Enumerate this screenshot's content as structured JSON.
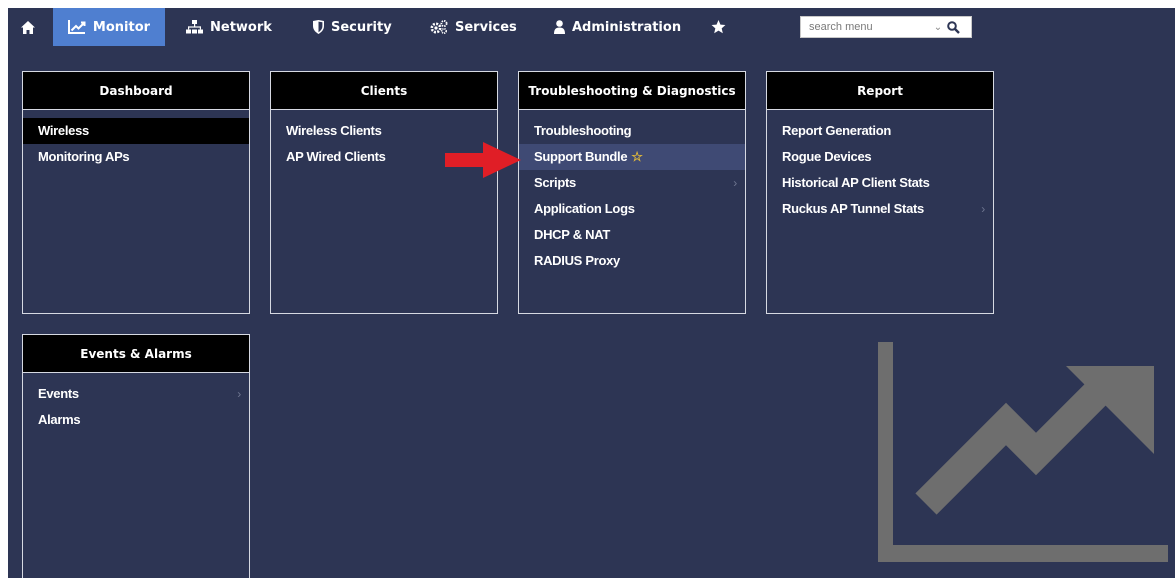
{
  "topnav": {
    "monitor": "Monitor",
    "network": "Network",
    "security": "Security",
    "services": "Services",
    "administration": "Administration",
    "search_placeholder": "search menu"
  },
  "icons": {
    "home": "home-icon",
    "monitor": "line-chart-icon",
    "network": "sitemap-icon",
    "security": "shield-icon",
    "services": "gears-icon",
    "administration": "user-icon",
    "favorites": "star-icon",
    "search": "search-icon",
    "pointer": "red-arrow-icon",
    "background": "trending-chart-icon"
  },
  "colors": {
    "background": "#2d3554",
    "active_tab": "#4f7fd0",
    "card_header": "#000000",
    "highlight_row": "#3f4a74",
    "arrow": "#e01e26",
    "favorite_star": "#e0b83a"
  },
  "cards": {
    "dashboard": {
      "title": "Dashboard",
      "items": [
        "Wireless",
        "Monitoring APs"
      ],
      "selected": "Wireless"
    },
    "clients": {
      "title": "Clients",
      "items": [
        "Wireless Clients",
        "AP Wired Clients"
      ]
    },
    "troubleshooting": {
      "title": "Troubleshooting & Diagnostics",
      "items": [
        "Troubleshooting",
        "Support Bundle",
        "Scripts",
        "Application Logs",
        "DHCP & NAT",
        "RADIUS Proxy"
      ],
      "highlighted": "Support Bundle"
    },
    "report": {
      "title": "Report",
      "items": [
        "Report Generation",
        "Rogue Devices",
        "Historical AP Client Stats",
        "Ruckus AP Tunnel Stats"
      ]
    },
    "events": {
      "title": "Events & Alarms",
      "items": [
        "Events",
        "Alarms"
      ]
    }
  }
}
